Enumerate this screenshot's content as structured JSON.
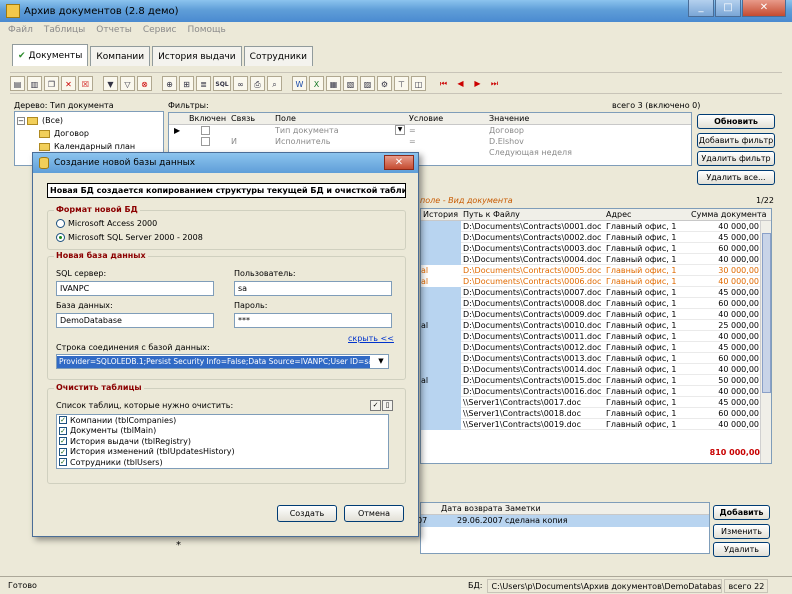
{
  "app": {
    "title": "Архив документов (2.8 демо)",
    "menu": [
      "Файл",
      "Таблицы",
      "Отчеты",
      "Сервис",
      "Помощь"
    ],
    "window_buttons": {
      "minimize": "_",
      "maximize": "□",
      "close": "✕"
    }
  },
  "tabs": [
    "Документы",
    "Компании",
    "История выдачи",
    "Сотрудники"
  ],
  "toolbar": {
    "icons": [
      "new-doc-icon",
      "open-icon",
      "copy-icon",
      "delete-icon",
      "delete-all-icon",
      "filter-icon",
      "filter-clear-icon",
      "filter-remove-icon",
      "attach-icon",
      "attach-folder-icon",
      "report-icon",
      "sql-icon",
      "binoculars-icon",
      "print-icon",
      "preview-icon",
      "word-icon",
      "excel-icon",
      "grid-icon",
      "grid2-icon",
      "grid3-icon",
      "settings-icon",
      "tree-icon",
      "db-icon",
      "first-icon",
      "prev-icon",
      "next-icon",
      "last-icon"
    ],
    "sql_label": "SQL"
  },
  "tree": {
    "label": "Дерево: Тип документа",
    "items": [
      "(Все)",
      "Договор",
      "Календарный план"
    ]
  },
  "filters": {
    "label": "Фильтры:",
    "count": "всего 3 (включено 0)",
    "columns": [
      "Включен",
      "Связь",
      "Поле",
      "Условие",
      "Значение"
    ],
    "rows": [
      {
        "link": "",
        "field": "Тип документа",
        "cond": "=",
        "value": "Договор"
      },
      {
        "link": "И",
        "field": "Исполнитель",
        "cond": "=",
        "value": "D.Elshov"
      },
      {
        "link": "",
        "field": "",
        "cond": "",
        "value": "Следующая неделя"
      }
    ]
  },
  "right_buttons": [
    "Обновить",
    "Добавить фильтр",
    "Удалить фильтр",
    "Удалить все..."
  ],
  "main": {
    "group_header": "поле - Вид документа",
    "page_count": "1/22",
    "columns": [
      "История",
      "Путь к Файлу",
      "Адрес",
      "Сумма документа"
    ],
    "rows": [
      {
        "c0": "",
        "path": "D:\\Documents\\Contracts\\0001.doc",
        "addr": "Главный офис, 1",
        "sum": "40 000,00",
        "orange": false
      },
      {
        "c0": "",
        "path": "D:\\Documents\\Contracts\\0002.doc",
        "addr": "Главный офис, 1",
        "sum": "45 000,00",
        "orange": false
      },
      {
        "c0": "",
        "path": "D:\\Documents\\Contracts\\0003.doc",
        "addr": "Главный офис, 1",
        "sum": "60 000,00",
        "orange": false
      },
      {
        "c0": "",
        "path": "D:\\Documents\\Contracts\\0004.doc",
        "addr": "Главный офис, 1",
        "sum": "40 000,00",
        "orange": false
      },
      {
        "c0": "al",
        "path": "D:\\Documents\\Contracts\\0005.doc",
        "addr": "Главный офис, 1",
        "sum": "30 000,00",
        "orange": true
      },
      {
        "c0": "al",
        "path": "D:\\Documents\\Contracts\\0006.doc",
        "addr": "Главный офис, 1",
        "sum": "40 000,00",
        "orange": true
      },
      {
        "c0": "",
        "path": "D:\\Documents\\Contracts\\0007.doc",
        "addr": "Главный офис, 1",
        "sum": "45 000,00",
        "orange": false
      },
      {
        "c0": "",
        "path": "D:\\Documents\\Contracts\\0008.doc",
        "addr": "Главный офис, 1",
        "sum": "60 000,00",
        "orange": false
      },
      {
        "c0": "",
        "path": "D:\\Documents\\Contracts\\0009.doc",
        "addr": "Главный офис, 1",
        "sum": "40 000,00",
        "orange": false
      },
      {
        "c0": "al",
        "path": "D:\\Documents\\Contracts\\0010.doc",
        "addr": "Главный офис, 1",
        "sum": "25 000,00",
        "orange": false
      },
      {
        "c0": "",
        "path": "D:\\Documents\\Contracts\\0011.doc",
        "addr": "Главный офис, 1",
        "sum": "40 000,00",
        "orange": false
      },
      {
        "c0": "",
        "path": "D:\\Documents\\Contracts\\0012.doc",
        "addr": "Главный офис, 1",
        "sum": "45 000,00",
        "orange": false
      },
      {
        "c0": "",
        "path": "D:\\Documents\\Contracts\\0013.doc",
        "addr": "Главный офис, 1",
        "sum": "60 000,00",
        "orange": false
      },
      {
        "c0": "",
        "path": "D:\\Documents\\Contracts\\0014.doc",
        "addr": "Главный офис, 1",
        "sum": "40 000,00",
        "orange": false
      },
      {
        "c0": "al",
        "path": "D:\\Documents\\Contracts\\0015.doc",
        "addr": "Главный офис, 1",
        "sum": "50 000,00",
        "orange": false
      },
      {
        "c0": "",
        "path": "D:\\Documents\\Contracts\\0016.doc",
        "addr": "Главный офис, 1",
        "sum": "40 000,00",
        "orange": false
      },
      {
        "c0": "",
        "path": "\\\\Server1\\Contracts\\0017.doc",
        "addr": "Главный офис, 1",
        "sum": "45 000,00",
        "orange": false
      },
      {
        "c0": "",
        "path": "\\\\Server1\\Contracts\\0018.doc",
        "addr": "Главный офис, 1",
        "sum": "60 000,00",
        "orange": false
      },
      {
        "c0": "",
        "path": "\\\\Server1\\Contracts\\0019.doc",
        "addr": "Главный офис, 1",
        "sum": "40 000,00",
        "orange": false
      }
    ],
    "total": "810 000,00"
  },
  "history": {
    "columns": [
      "Дата возврата",
      "Заметки"
    ],
    "rows": [
      {
        "lead": "07",
        "date": "29.06.2007",
        "note": "сделана копия"
      }
    ],
    "new_row": "*"
  },
  "history_buttons": [
    "Добавить",
    "Изменить",
    "Удалить"
  ],
  "status": {
    "ready": "Готово",
    "db_label": "БД:",
    "db_path": "C:\\Users\\p\\Documents\\Архив документов\\DemoDatabase.mdb",
    "total": "всего 22"
  },
  "dialog": {
    "title": "Создание новой базы данных",
    "banner": "Новая БД создается копированием структуры текущей БД и очисткой таблиц",
    "format": {
      "legend": "Формат новой БД",
      "options": [
        "Microsoft Access 2000",
        "Microsoft SQL Server 2000 - 2008"
      ],
      "selected": 1
    },
    "newdb": {
      "legend": "Новая база данных",
      "server_label": "SQL сервер:",
      "server": "IVANPC",
      "user_label": "Пользователь:",
      "user": "sa",
      "db_label": "База данных:",
      "db": "DemoDatabase",
      "pass_label": "Пароль:",
      "pass": "***",
      "hide_link": "скрыть <<",
      "conn_label": "Строка соединения с базой данных:",
      "conn": "Provider=SQLOLEDB.1;Persist Security Info=False;Data Source=IVANPC;User ID=sa"
    },
    "clear": {
      "legend": "Очистить таблицы",
      "list_label": "Список таблиц, которые нужно очистить:",
      "tables": [
        "Компании (tblCompanies)",
        "Документы (tblMain)",
        "История выдачи (tblRegistry)",
        "История изменений (tblUpdatesHistory)",
        "Сотрудники (tblUsers)"
      ],
      "check_all": "✓",
      "clear_all": "▯"
    },
    "create_btn": "Создать",
    "cancel_btn": "Отмена"
  }
}
